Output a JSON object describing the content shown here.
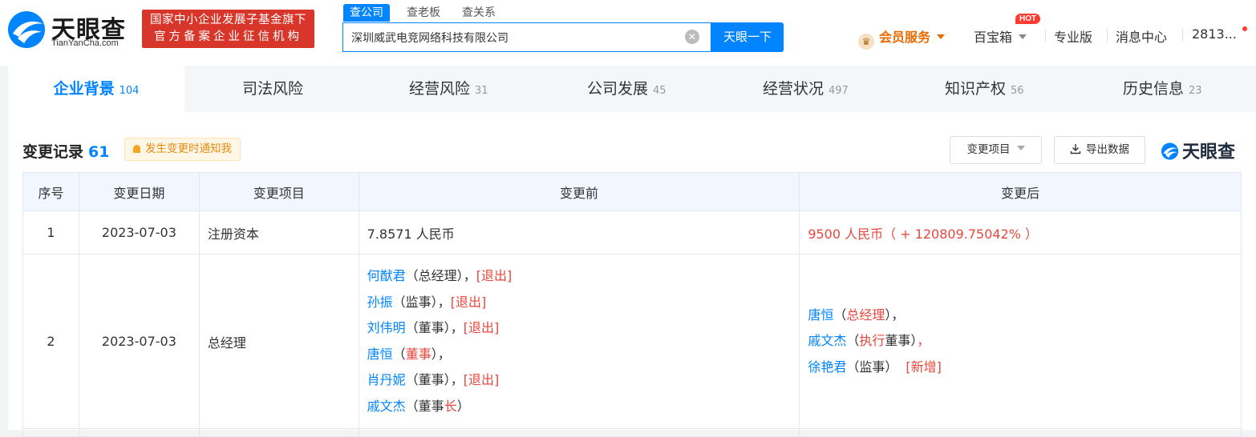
{
  "header": {
    "logo_text": "天眼查",
    "logo_sub": "TianYanCha.com",
    "badge_line1": "国家中小企业发展子基金旗下",
    "badge_line2": "官方备案企业征信机构",
    "search_tabs": [
      "查公司",
      "查老板",
      "查关系"
    ],
    "search_value": "深圳威武电竞网络科技有限公司",
    "search_button": "天眼一下",
    "vip_label": "会员服务",
    "vip_icon": "crown-icon",
    "baobox_label": "百宝箱",
    "hot_label": "HOT",
    "pro_label": "专业版",
    "msg_label": "消息中心",
    "user_label": "2813..."
  },
  "tabs": [
    {
      "label": "企业背景",
      "count": "104"
    },
    {
      "label": "司法风险",
      "count": ""
    },
    {
      "label": "经营风险",
      "count": "31"
    },
    {
      "label": "公司发展",
      "count": "45"
    },
    {
      "label": "经营状况",
      "count": "497"
    },
    {
      "label": "知识产权",
      "count": "56"
    },
    {
      "label": "历史信息",
      "count": "23"
    }
  ],
  "section": {
    "title": "变更记录",
    "count": "61",
    "notify_label": "发生变更时通知我",
    "filter_label": "变更项目",
    "export_label": "导出数据",
    "brand_label": "天眼查"
  },
  "table": {
    "headers": [
      "序号",
      "变更日期",
      "变更项目",
      "变更前",
      "变更后"
    ],
    "row1": {
      "no": "1",
      "date": "2023-07-03",
      "item": "注册资本",
      "before": "7.8571 人民币",
      "after": "9500 人民币（ + 120809.75042% ）"
    },
    "row2": {
      "no": "2",
      "date": "2023-07-03",
      "item": "总经理",
      "before": [
        {
          "name": "何猷君",
          "a": "（总经理）",
          "b": "",
          "c": "，",
          "tag": "[退出]"
        },
        {
          "name": "孙振",
          "a": "（监事）",
          "b": "",
          "c": "，",
          "tag": "[退出]"
        },
        {
          "name": "刘伟明",
          "a": "（董事）",
          "b": "",
          "c": "，",
          "tag": "[退出]"
        },
        {
          "name": "唐恒",
          "a": "（",
          "b": "董事",
          "c": "）",
          "tag": "，"
        },
        {
          "name": "肖丹妮",
          "a": "（董事）",
          "b": "",
          "c": "，",
          "tag": "[退出]"
        },
        {
          "name": "戚文杰",
          "a": "（董事",
          "b": "长",
          "c": "）",
          "tag": ""
        }
      ],
      "after": [
        {
          "name": "唐恒",
          "a": "（",
          "b": "总经理",
          "c": "）",
          "tag": "，"
        },
        {
          "name": "戚文杰",
          "a": "（",
          "b": "执行",
          "c": "董事）",
          "tag": "，"
        },
        {
          "name": "徐艳君",
          "a": "（监事）",
          "b": "",
          "c": "",
          "tag": "[新增]"
        }
      ]
    }
  }
}
